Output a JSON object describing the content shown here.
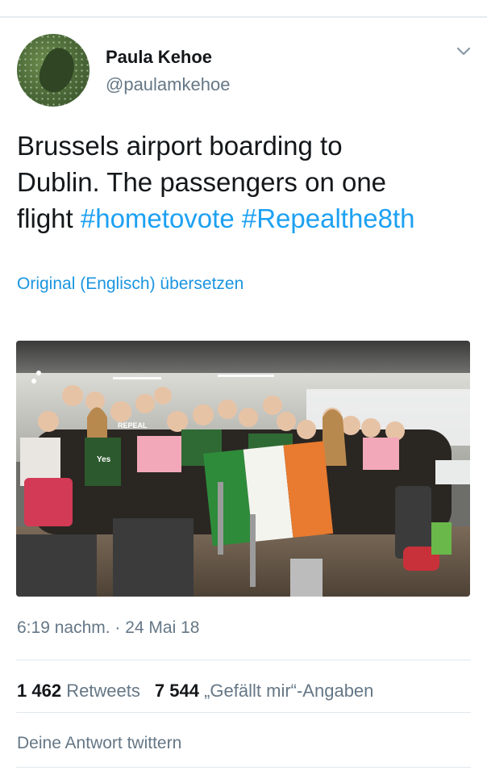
{
  "author": {
    "name": "Paula Kehoe",
    "handle": "@paulamkehoe"
  },
  "tweet": {
    "text_line1": "Brussels airport boarding to",
    "text_line2": "Dublin. The passengers on one",
    "text_line3_prefix": "flight ",
    "hashtag1": "#hometovote",
    "hashtag2": "#Repealthe8th",
    "translate_label": "Original (Englisch) übersetzen"
  },
  "meta": {
    "timestamp": "6:19 nachm. · 24 Mai 18",
    "retweet_count": "1 462",
    "retweet_label": "Retweets",
    "like_count": "7 544",
    "like_label": "„Gefällt mir“-Angaben"
  },
  "reply": {
    "placeholder": "Deine Antwort twittern"
  },
  "photo": {
    "banner_text": "REPEAL",
    "shirt_text": "Yes"
  },
  "colors": {
    "link": "#1da1f2",
    "muted": "#657786",
    "text": "#14171a"
  },
  "icons": {
    "menu": "chevron-down-icon"
  }
}
